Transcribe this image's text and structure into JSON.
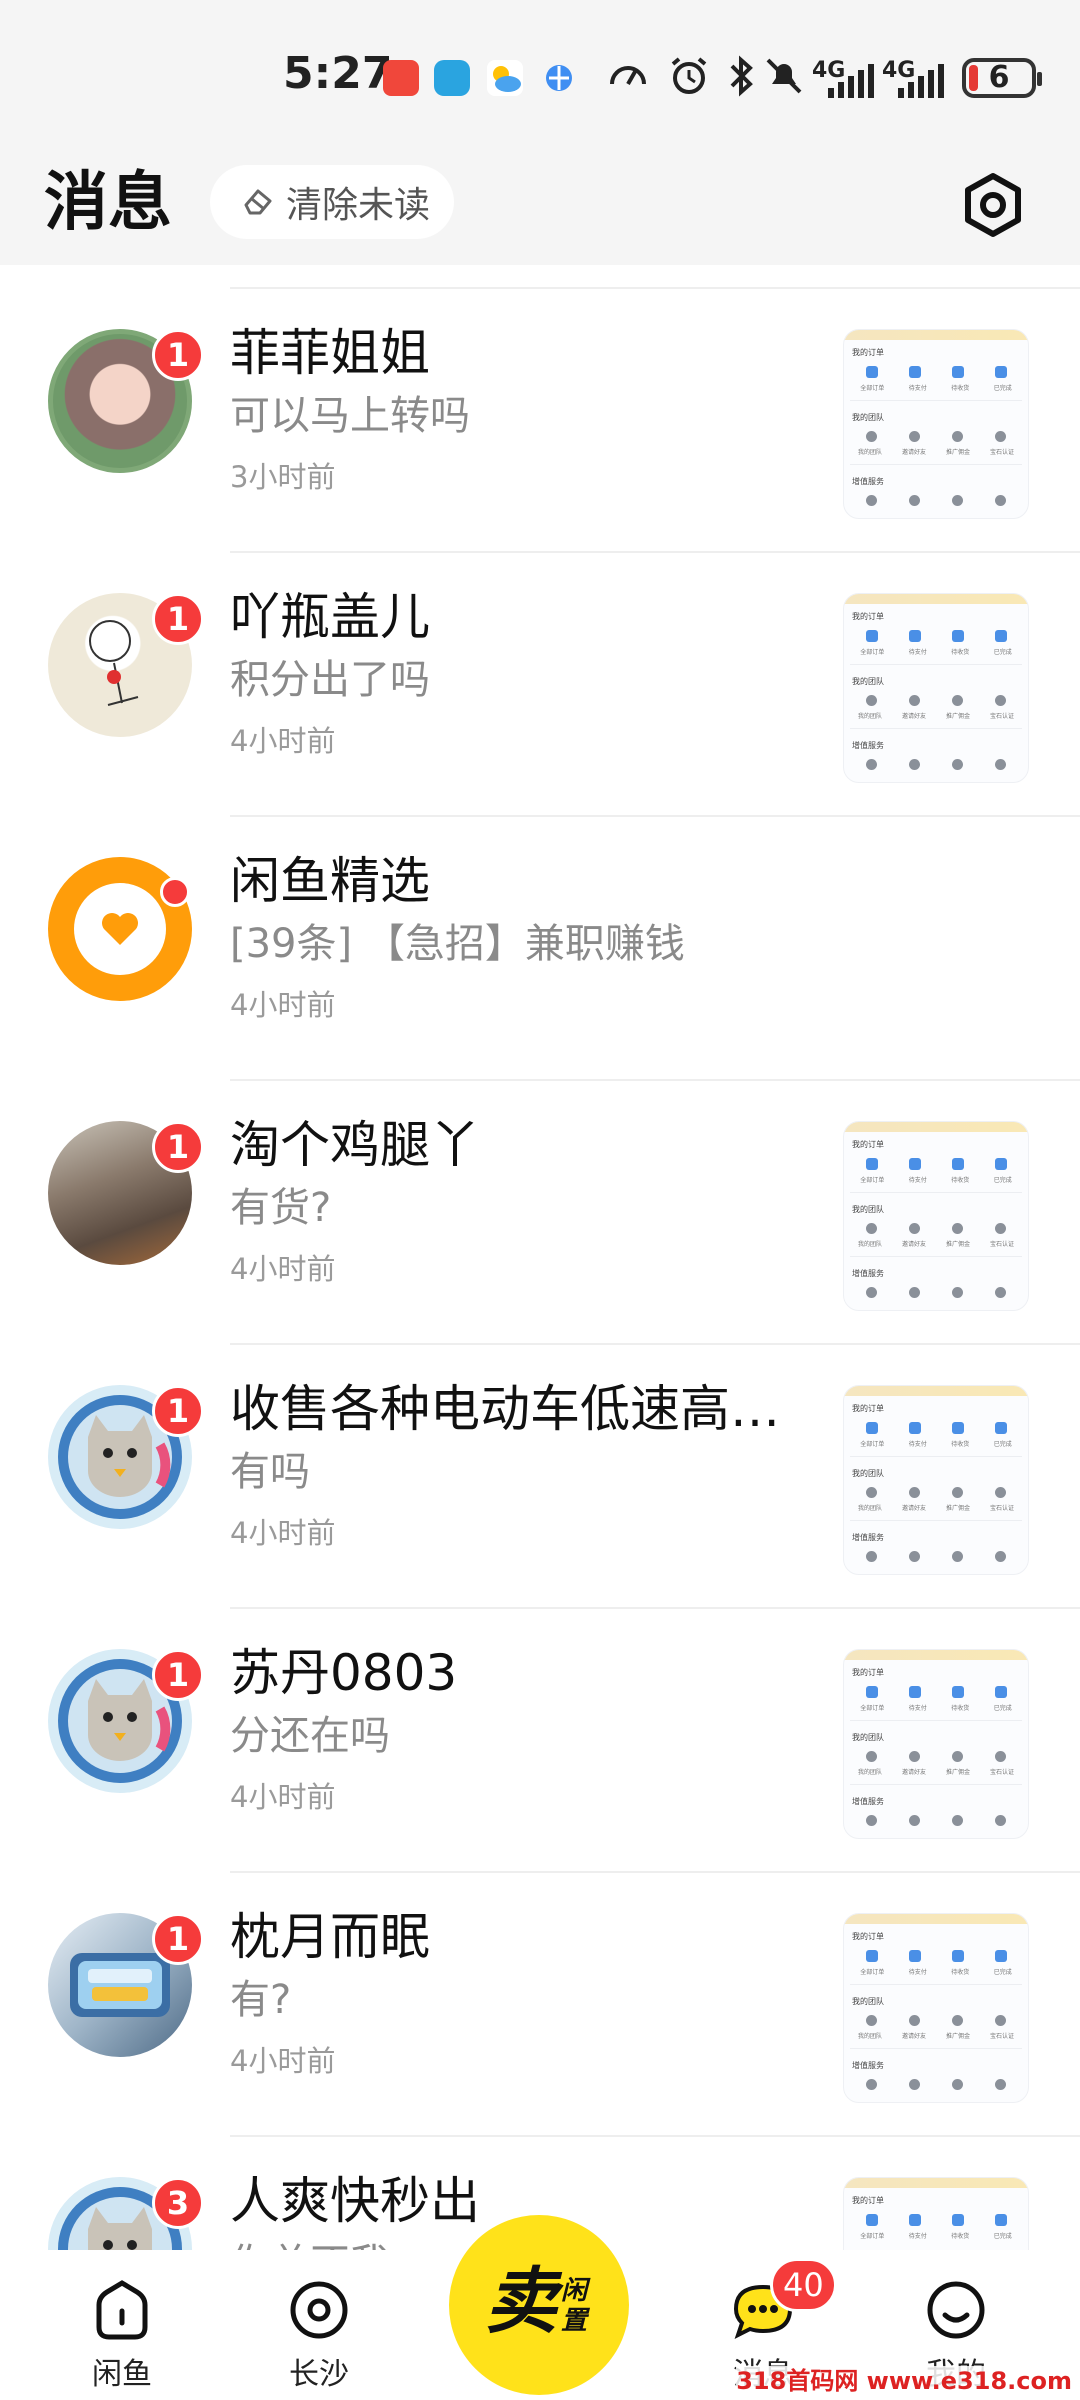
{
  "status_bar": {
    "time": "5:27",
    "network_1": "4G",
    "network_2": "4G",
    "battery": "6",
    "icons": [
      "battery-saver-icon",
      "app-notify-icon",
      "weather-icon",
      "browser-icon",
      "speed-icon",
      "alarm-icon",
      "bluetooth-icon",
      "mute-icon"
    ]
  },
  "header": {
    "title": "消息",
    "clear_unread_label": "清除未读"
  },
  "messages": [
    {
      "name": "菲菲姐姐",
      "preview": "可以马上转吗",
      "time": "3小时前",
      "badge": "1",
      "has_thumb": true
    },
    {
      "name": "吖瓶盖儿",
      "preview": "积分出了吗",
      "time": "4小时前",
      "badge": "1",
      "has_thumb": true
    },
    {
      "name": "闲鱼精选",
      "preview": "[39条] 【急招】兼职赚钱",
      "time": "4小时前",
      "badge": "",
      "has_thumb": false
    },
    {
      "name": "淘个鸡腿丫",
      "preview": "有货?",
      "time": "4小时前",
      "badge": "1",
      "has_thumb": true
    },
    {
      "name": "收售各种电动车低速高…",
      "preview": "有吗",
      "time": "4小时前",
      "badge": "1",
      "has_thumb": true
    },
    {
      "name": "苏丹0803",
      "preview": "分还在吗",
      "time": "4小时前",
      "badge": "1",
      "has_thumb": true
    },
    {
      "name": "枕月而眠",
      "preview": "有?",
      "time": "4小时前",
      "badge": "1",
      "has_thumb": true
    },
    {
      "name": "人爽快秒出",
      "preview": "你总不我",
      "time": "",
      "badge": "3",
      "has_thumb": true
    }
  ],
  "thumb": {
    "section1": "我的订单",
    "caps1": [
      "全部订单",
      "待支付",
      "待收货",
      "已完成"
    ],
    "section2": "我的团队",
    "caps2": [
      "我的团队",
      "邀请好友",
      "推广佣金",
      "宝石认证"
    ],
    "section3": "增值服务"
  },
  "tabbar": {
    "tab_home": "闲鱼",
    "tab_city": "长沙",
    "sell_big": "卖",
    "sell_small_1": "闲",
    "sell_small_2": "置",
    "tab_messages": "消息",
    "messages_badge": "40",
    "tab_mine": "我的"
  },
  "watermark": "318首码网 www.e318.com",
  "colors": {
    "accent_yellow": "#ffe21a",
    "badge_red": "#f53b3b",
    "orange": "#ff9d0a"
  }
}
